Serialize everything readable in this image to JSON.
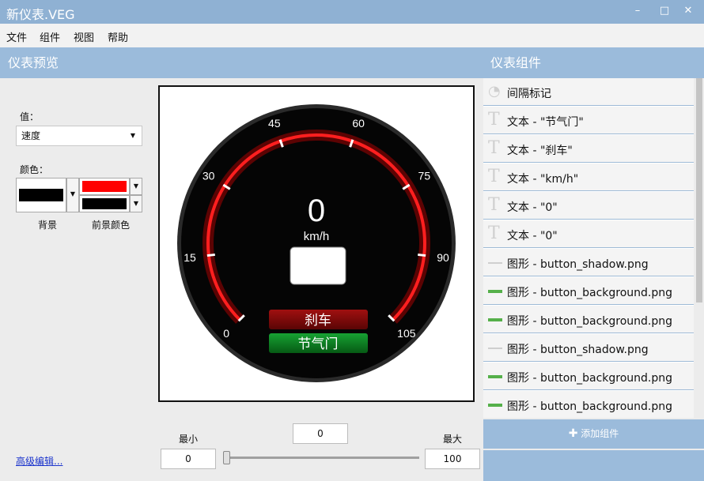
{
  "window": {
    "title": "新仪表.VEG",
    "minimize_icon": "minimize-icon",
    "maximize_icon": "maximize-icon",
    "close_icon": "close-icon"
  },
  "menu": [
    "文件",
    "组件",
    "视图",
    "帮助"
  ],
  "left_panel": {
    "title": "仪表预览",
    "value_label": "值：",
    "value_select": "速度",
    "color_label": "颜色：",
    "background_label": "背景",
    "foreground_label": "前景颜色",
    "colors": {
      "background": "#000000",
      "foreground_1": "#ff0000",
      "foreground_2": "#000000"
    },
    "advanced_link": "高级编辑..."
  },
  "gauge": {
    "value": "0",
    "unit": "km/h",
    "brake_label": "刹车",
    "throttle_label": "节气门",
    "ticks": [
      "0",
      "15",
      "30",
      "45",
      "60",
      "75",
      "90",
      "105"
    ],
    "colors": {
      "arc": "#ff2020",
      "brake": "#8c0a0a",
      "throttle": "#0a7a1e"
    }
  },
  "range": {
    "min_label": "最小",
    "max_label": "最大",
    "min_value": "0",
    "max_value": "100",
    "current": "0",
    "slider_fraction": 0
  },
  "right_panel": {
    "title": "仪表组件",
    "items": [
      {
        "label": "间隔标记",
        "icon": "arc-ticks-icon"
      },
      {
        "label": "文本 - \"节气门\"",
        "icon": "text-icon"
      },
      {
        "label": "文本 - \"刹车\"",
        "icon": "text-icon"
      },
      {
        "label": "文本 - \"km/h\"",
        "icon": "text-icon"
      },
      {
        "label": "文本 - \"0\"",
        "icon": "text-icon"
      },
      {
        "label": "文本 - \"0\"",
        "icon": "text-icon"
      },
      {
        "label": "图形 - button_shadow.png",
        "icon": "shadow-line-icon"
      },
      {
        "label": "图形 - button_background.png",
        "icon": "green-bar-icon"
      },
      {
        "label": "图形 - button_background.png",
        "icon": "green-bar-icon"
      },
      {
        "label": "图形 - button_shadow.png",
        "icon": "shadow-line-icon"
      },
      {
        "label": "图形 - button_background.png",
        "icon": "green-bar-icon"
      },
      {
        "label": "图形 - button_background.png",
        "icon": "green-bar-icon"
      }
    ],
    "add_button": "添加组件",
    "add_icon": "plus-icon"
  }
}
